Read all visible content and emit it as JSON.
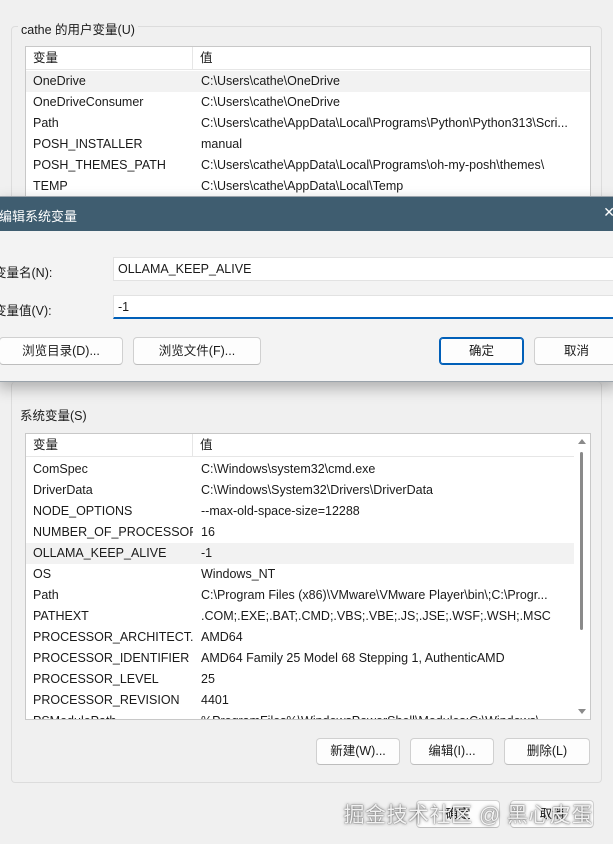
{
  "user_vars": {
    "title": "cathe 的用户变量(U)",
    "col_var": "变量",
    "col_val": "值",
    "rows": [
      {
        "name": "OneDrive",
        "value": "C:\\Users\\cathe\\OneDrive"
      },
      {
        "name": "OneDriveConsumer",
        "value": "C:\\Users\\cathe\\OneDrive"
      },
      {
        "name": "Path",
        "value": "C:\\Users\\cathe\\AppData\\Local\\Programs\\Python\\Python313\\Scri..."
      },
      {
        "name": "POSH_INSTALLER",
        "value": "manual"
      },
      {
        "name": "POSH_THEMES_PATH",
        "value": "C:\\Users\\cathe\\AppData\\Local\\Programs\\oh-my-posh\\themes\\"
      },
      {
        "name": "TEMP",
        "value": "C:\\Users\\cathe\\AppData\\Local\\Temp"
      }
    ]
  },
  "dialog": {
    "title": "编辑系统变量",
    "close": "✕",
    "name_label": "变量名(N):",
    "name_value": "OLLAMA_KEEP_ALIVE",
    "value_label": "变量值(V):",
    "value_value": "-1",
    "browse_dir": "浏览目录(D)...",
    "browse_file": "浏览文件(F)...",
    "ok": "确定",
    "cancel": "取消"
  },
  "system_vars": {
    "title": "系统变量(S)",
    "col_var": "变量",
    "col_val": "值",
    "rows": [
      {
        "name": "ComSpec",
        "value": "C:\\Windows\\system32\\cmd.exe"
      },
      {
        "name": "DriverData",
        "value": "C:\\Windows\\System32\\Drivers\\DriverData"
      },
      {
        "name": "NODE_OPTIONS",
        "value": "--max-old-space-size=12288"
      },
      {
        "name": "NUMBER_OF_PROCESSORS",
        "value": "16"
      },
      {
        "name": "OLLAMA_KEEP_ALIVE",
        "value": "-1"
      },
      {
        "name": "OS",
        "value": "Windows_NT"
      },
      {
        "name": "Path",
        "value": "C:\\Program Files (x86)\\VMware\\VMware Player\\bin\\;C:\\Progr..."
      },
      {
        "name": "PATHEXT",
        "value": ".COM;.EXE;.BAT;.CMD;.VBS;.VBE;.JS;.JSE;.WSF;.WSH;.MSC"
      },
      {
        "name": "PROCESSOR_ARCHITECT...",
        "value": "AMD64"
      },
      {
        "name": "PROCESSOR_IDENTIFIER",
        "value": "AMD64 Family 25 Model 68 Stepping 1, AuthenticAMD"
      },
      {
        "name": "PROCESSOR_LEVEL",
        "value": "25"
      },
      {
        "name": "PROCESSOR_REVISION",
        "value": "4401"
      },
      {
        "name": "PSModulePath",
        "value": "%ProgramFiles%\\WindowsPowerShell\\Modules;C:\\Windows\\..."
      }
    ],
    "btn_new": "新建(W)...",
    "btn_edit": "编辑(I)...",
    "btn_delete": "删除(L)"
  },
  "footer": {
    "ok": "确定",
    "cancel": "取消"
  },
  "watermark": "掘金技术社区 @ 黑心皮蛋"
}
